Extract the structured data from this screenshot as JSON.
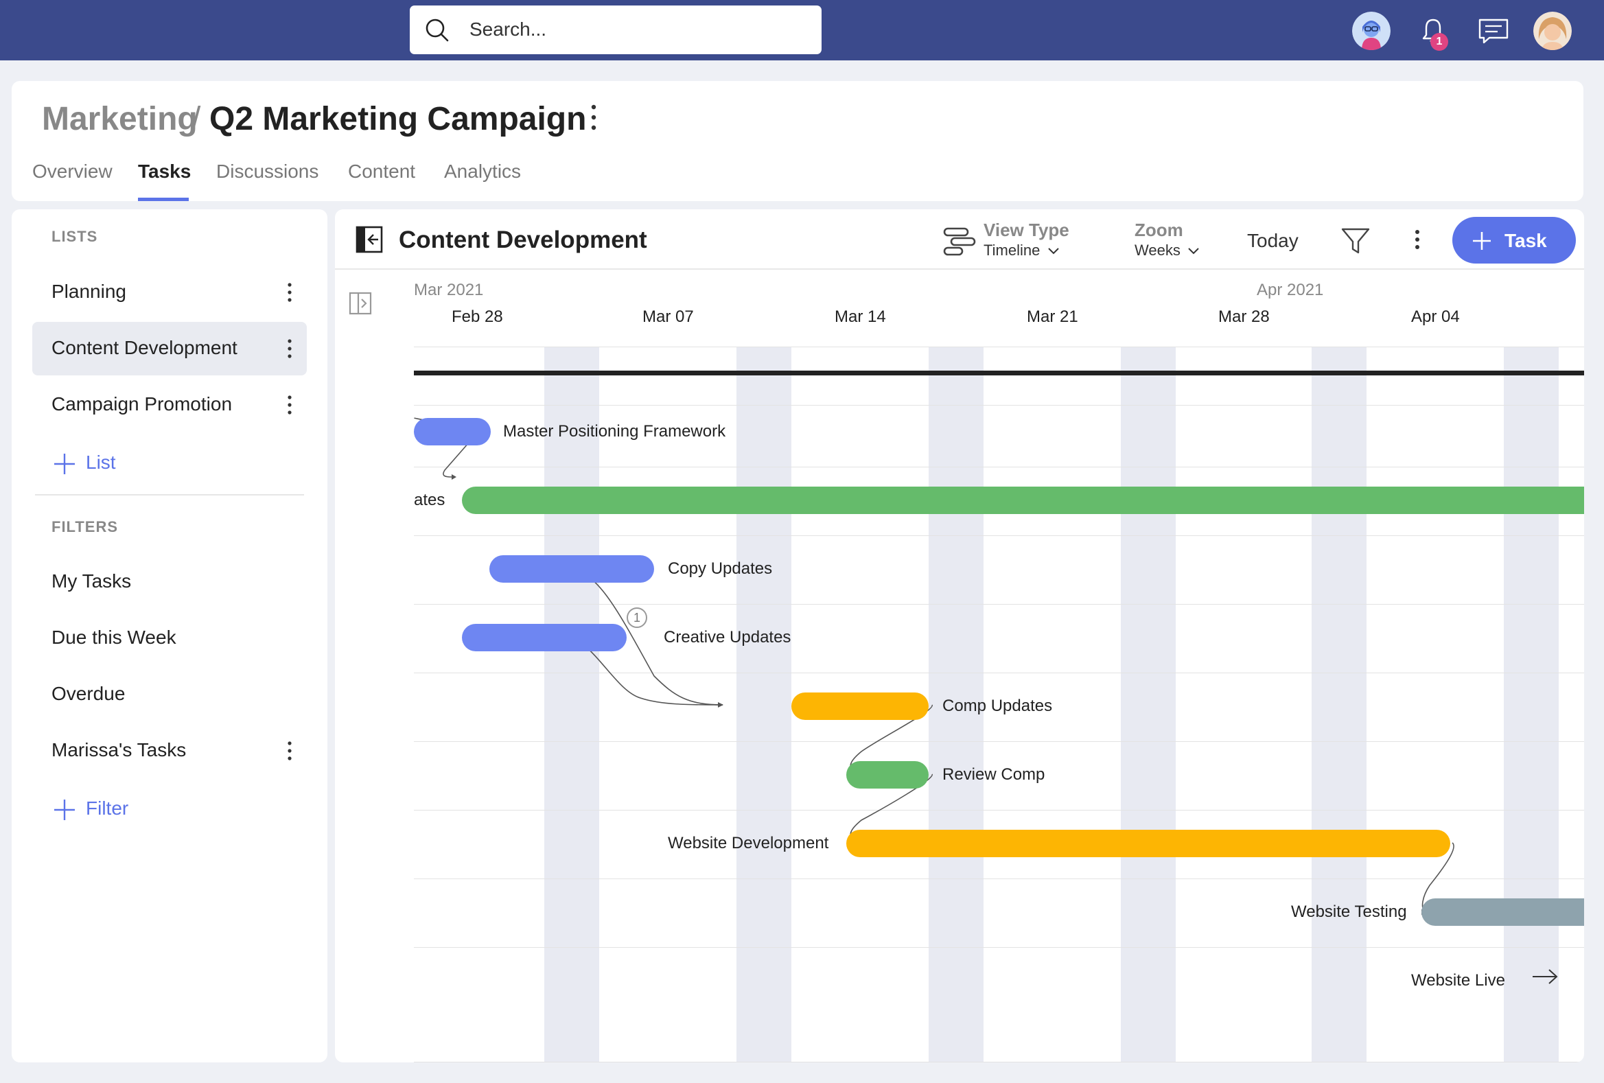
{
  "topbar": {
    "search_placeholder": "Search...",
    "notification_count": "1",
    "brand_color": "#3b4a8c"
  },
  "header": {
    "breadcrumb_parent": "Marketing",
    "breadcrumb_sep": "/",
    "title": "Q2 Marketing Campaign",
    "tabs": [
      {
        "label": "Overview"
      },
      {
        "label": "Tasks"
      },
      {
        "label": "Discussions"
      },
      {
        "label": "Content"
      },
      {
        "label": "Analytics"
      }
    ],
    "active_tab": "Tasks"
  },
  "sidebar": {
    "lists_title": "LISTS",
    "lists": [
      {
        "label": "Planning"
      },
      {
        "label": "Content Development"
      },
      {
        "label": "Campaign Promotion"
      }
    ],
    "add_list_label": "List",
    "filters_title": "FILTERS",
    "filters": [
      {
        "label": "My Tasks"
      },
      {
        "label": "Due this Week"
      },
      {
        "label": "Overdue"
      },
      {
        "label": "Marissa's Tasks"
      }
    ],
    "add_filter_label": "Filter"
  },
  "main": {
    "title": "Content Development",
    "view_type_title": "View Type",
    "view_type_value": "Timeline",
    "zoom_title": "Zoom",
    "zoom_value": "Weeks",
    "today_label": "Today",
    "task_button_label": "Task"
  },
  "timeline": {
    "months": [
      "Mar 2021",
      "Apr 2021"
    ],
    "weeks": [
      "Feb 28",
      "Mar 07",
      "Mar 14",
      "Mar 21",
      "Mar 28",
      "Apr 04"
    ],
    "tasks": [
      {
        "name": "Master Positioning Framework",
        "color": "blue"
      },
      {
        "name": "ates",
        "color": "green"
      },
      {
        "name": "Copy Updates",
        "color": "blue"
      },
      {
        "name": "Creative Updates",
        "color": "blue"
      },
      {
        "name": "Comp Updates",
        "color": "yellow"
      },
      {
        "name": "Review Comp",
        "color": "green"
      },
      {
        "name": "Website Development",
        "color": "yellow"
      },
      {
        "name": "Website Testing",
        "color": "gray"
      },
      {
        "name": "Website Live",
        "color": "none"
      }
    ],
    "dependency_badge": "1",
    "colors": {
      "blue": "#6e86f2",
      "green": "#65bb6b",
      "yellow": "#fdb503",
      "gray": "#8ea3ad"
    }
  }
}
